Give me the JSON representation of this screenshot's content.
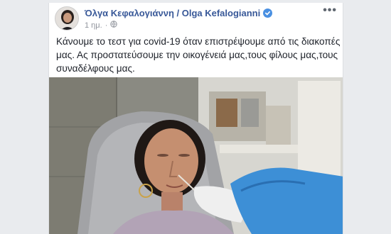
{
  "post": {
    "author_name": "Όλγα Κεφαλογιάννη / Olga Kefalogianni",
    "timestamp": "1 ημ.",
    "separator": "·",
    "audience_icon": "globe-icon",
    "verified_icon": "verified-badge-icon",
    "more_icon": "more-options-icon",
    "more_label": "•••",
    "text": "Κάνουμε το τεστ για covid-19 όταν επιστρέψουμε από τις διακοπές μας. Ας προστατεύσουμε την οικογένειά μας,τους φίλους μας,τους συναδέλφους μας."
  },
  "colors": {
    "author_link": "#385898",
    "body_text": "#1d2129",
    "meta_text": "#90949c",
    "page_background": "#e9ebee",
    "glove_blue": "#3d8fd6"
  }
}
